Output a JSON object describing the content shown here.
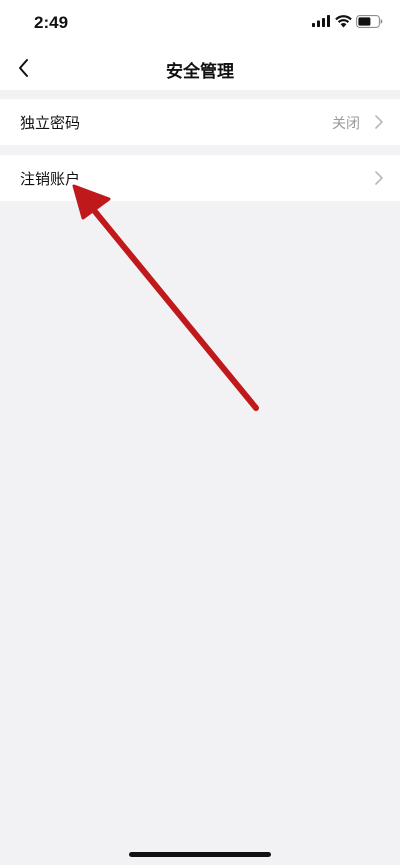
{
  "status_bar": {
    "time": "2:49"
  },
  "nav": {
    "back_icon": "chevron-left-icon",
    "title": "安全管理"
  },
  "rows": [
    {
      "label": "独立密码",
      "value": "关闭",
      "icon": "chevron-right-icon"
    },
    {
      "label": "注销账户",
      "value": "",
      "icon": "chevron-right-icon"
    }
  ],
  "colors": {
    "background": "#f2f2f4",
    "surface": "#ffffff",
    "secondary_text": "#9a9a9a",
    "annotation_arrow": "#c0191c"
  }
}
